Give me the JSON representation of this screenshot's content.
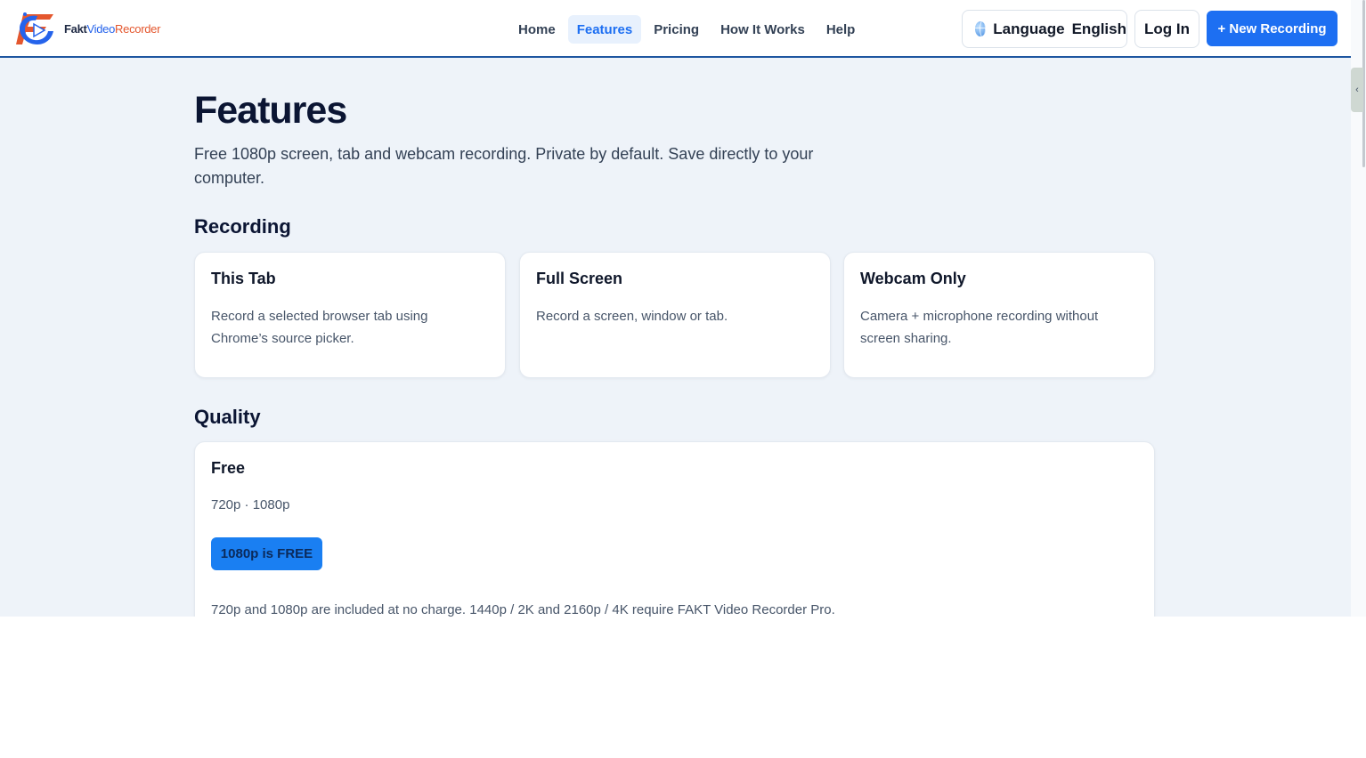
{
  "brand": {
    "name_part1": "Fakt",
    "name_part2": "Video",
    "name_part3": "Recorder"
  },
  "nav": {
    "items": [
      {
        "label": "Home",
        "active": false
      },
      {
        "label": "Features",
        "active": true
      },
      {
        "label": "Pricing",
        "active": false
      },
      {
        "label": "How It Works",
        "active": false
      },
      {
        "label": "Help",
        "active": false
      }
    ]
  },
  "header_actions": {
    "language_label": "Language",
    "language_value": "English",
    "login_label": "Log In",
    "new_recording_label": "+ New Recording"
  },
  "page": {
    "title": "Features",
    "subtitle": "Free 1080p screen, tab and webcam recording. Private by default. Save directly to your computer."
  },
  "recording": {
    "heading": "Recording",
    "cards": [
      {
        "title": "This Tab",
        "description": "Record a selected browser tab using Chrome’s source picker."
      },
      {
        "title": "Full Screen",
        "description": "Record a screen, window or tab."
      },
      {
        "title": "Webcam Only",
        "description": "Camera + microphone recording without screen sharing."
      }
    ]
  },
  "quality": {
    "heading": "Quality",
    "plan_title": "Free",
    "resolutions": "720p · 1080p",
    "badge": "1080p is FREE",
    "note": "720p and 1080p are included at no charge. 1440p / 2K and 2160p / 4K require FAKT Video Recorder Pro."
  },
  "colors": {
    "accent": "#1d6ff2",
    "page_background": "#eef3f9",
    "header_border": "#1e56a0",
    "heading_text": "#0b1533"
  },
  "icons": {
    "logo": "fakt-logo-icon",
    "language": "globe-icon",
    "side_tab": "chevron-left-icon"
  }
}
